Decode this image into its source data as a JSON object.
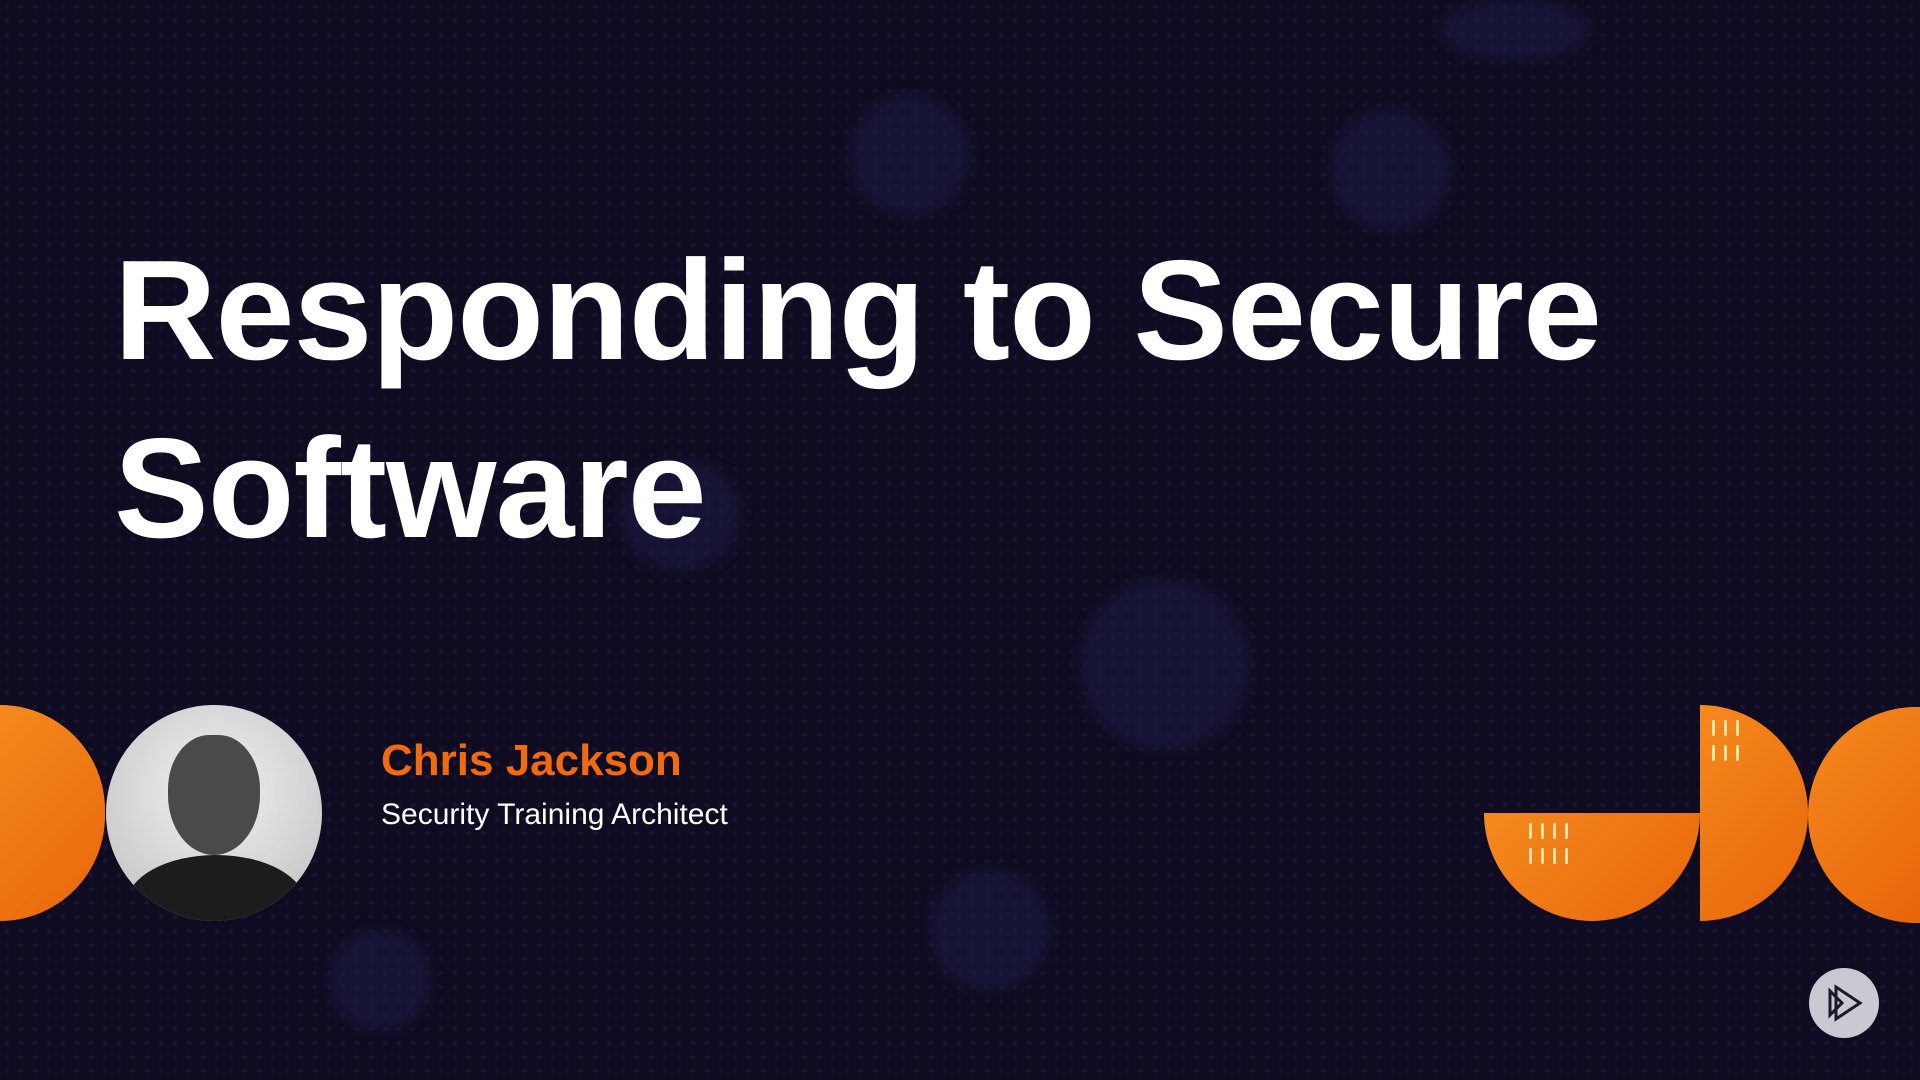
{
  "slide": {
    "title_line1": "Responding to Secure",
    "title_line2": "Software",
    "presenter_name": "Chris Jackson",
    "presenter_role": "Security Training Architect"
  },
  "colors": {
    "background": "#0f0c22",
    "accent": "#f26a0f",
    "text": "#ffffff"
  },
  "icons": {
    "play": "play-logo-icon"
  }
}
